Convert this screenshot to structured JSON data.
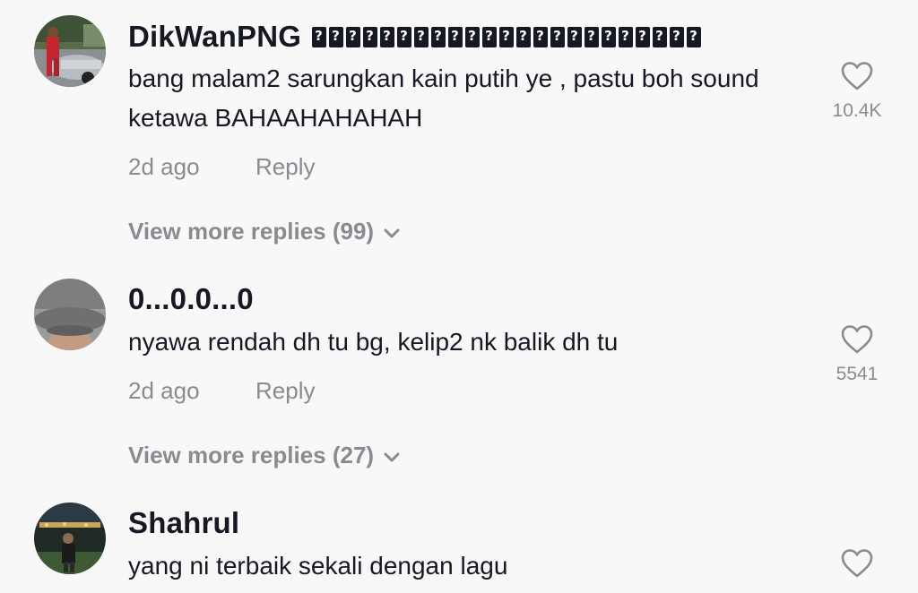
{
  "comments": [
    {
      "username": "DikWanPNG",
      "username_glyphs": 23,
      "text": "bang malam2 sarungkan kain putih ye , pastu boh sound ketawa BAHAAHAHAHAH",
      "time": "2d ago",
      "reply_label": "Reply",
      "likes": "10.4K",
      "view_more": "View more replies (99)"
    },
    {
      "username": "0...0.0...0",
      "text": "nyawa rendah dh tu bg, kelip2 nk balik dh tu",
      "time": "2d ago",
      "reply_label": "Reply",
      "likes": "5541",
      "view_more": "View more replies (27)"
    },
    {
      "username": "Shahrul",
      "text": "yang ni terbaik sekali dengan lagu",
      "time": "",
      "reply_label": "",
      "likes": "",
      "view_more": ""
    }
  ],
  "colors": {
    "background": "#f8f8f8",
    "primary_text": "#161823",
    "secondary_text": "#8a8b91"
  },
  "icons": {
    "like": "heart-outline-icon",
    "expand": "chevron-down-icon"
  }
}
